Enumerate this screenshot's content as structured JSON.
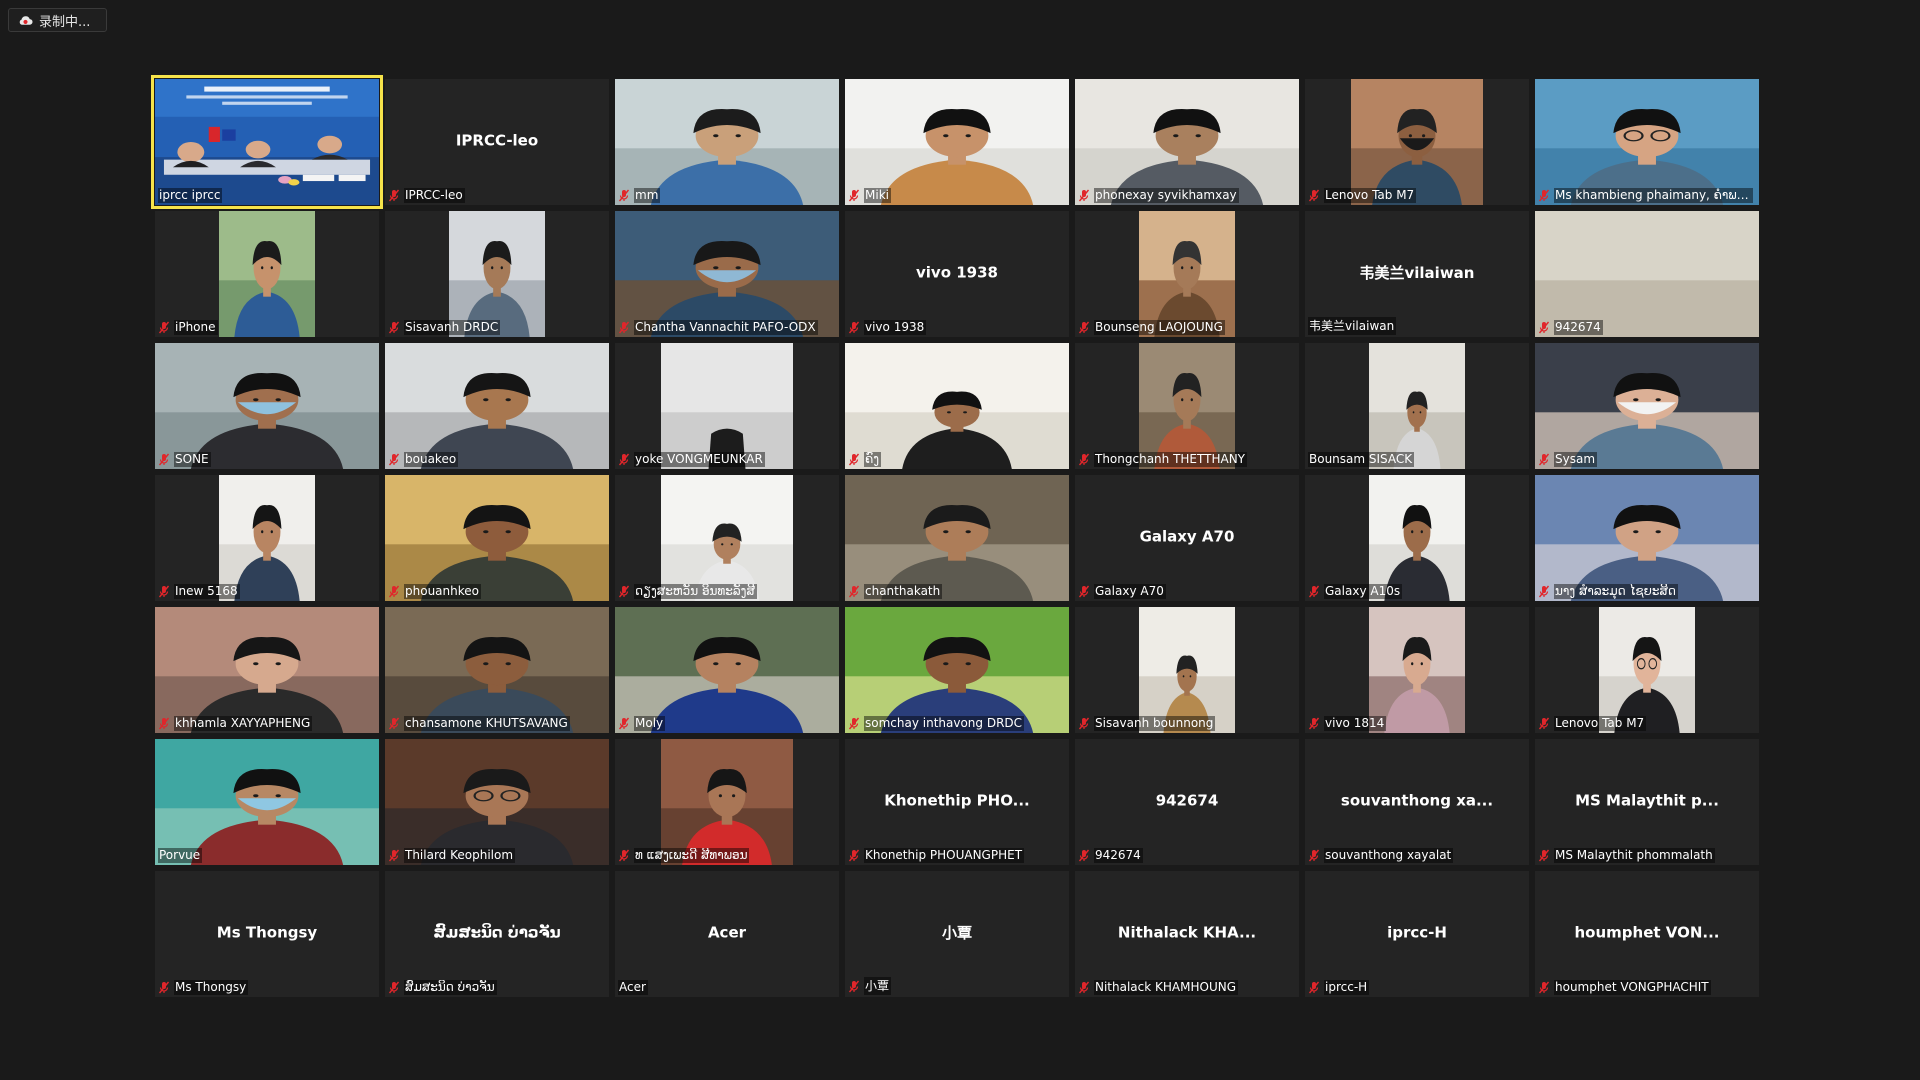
{
  "recording": {
    "label": "录制中...",
    "icon": "cloud-record-icon"
  },
  "colors": {
    "active_speaker_border": "#f6e34a",
    "tile_bg": "#242424",
    "mute_icon": "#e0262b"
  },
  "participants": [
    {
      "display_name": "iprcc iprcc",
      "center_name": "",
      "muted": false,
      "video": true,
      "active": true
    },
    {
      "display_name": "IPRCC-leo",
      "center_name": "IPRCC-leo",
      "muted": true,
      "video": false
    },
    {
      "display_name": "mm",
      "center_name": "",
      "muted": true,
      "video": true
    },
    {
      "display_name": "Miki",
      "center_name": "",
      "muted": true,
      "video": true
    },
    {
      "display_name": "phonexay syvikhamxay",
      "center_name": "",
      "muted": true,
      "video": true
    },
    {
      "display_name": "Lenovo Tab M7",
      "center_name": "",
      "muted": true,
      "video": true
    },
    {
      "display_name": "Ms khambieng phaimany, ຄຳພຽງ...",
      "center_name": "",
      "muted": true,
      "video": true
    },
    {
      "display_name": "iPhone",
      "center_name": "",
      "muted": true,
      "video": true
    },
    {
      "display_name": "Sisavanh DRDC",
      "center_name": "",
      "muted": true,
      "video": true
    },
    {
      "display_name": "Chantha Vannachit PAFO-ODX",
      "center_name": "",
      "muted": true,
      "video": true
    },
    {
      "display_name": "vivo 1938",
      "center_name": "vivo 1938",
      "muted": true,
      "video": false
    },
    {
      "display_name": "Bounseng LAOJOUNG",
      "center_name": "",
      "muted": true,
      "video": true
    },
    {
      "display_name": "韦美兰vilaiwan",
      "center_name": "韦美兰vilaiwan",
      "muted": false,
      "video": false
    },
    {
      "display_name": "942674",
      "center_name": "",
      "muted": true,
      "video": true
    },
    {
      "display_name": "SONE",
      "center_name": "",
      "muted": true,
      "video": true
    },
    {
      "display_name": "bouakeo",
      "center_name": "",
      "muted": true,
      "video": true
    },
    {
      "display_name": "yoke VONGMEUNKAR",
      "center_name": "",
      "muted": true,
      "video": true
    },
    {
      "display_name": "ຄົງ",
      "center_name": "",
      "muted": true,
      "video": true
    },
    {
      "display_name": "Thongchanh THETTHANY",
      "center_name": "",
      "muted": true,
      "video": true
    },
    {
      "display_name": "Bounsam SISACK",
      "center_name": "",
      "muted": false,
      "video": true
    },
    {
      "display_name": "Sysam",
      "center_name": "",
      "muted": true,
      "video": true
    },
    {
      "display_name": "Inew 5168",
      "center_name": "",
      "muted": true,
      "video": true
    },
    {
      "display_name": "phouanhkeo",
      "center_name": "",
      "muted": true,
      "video": true
    },
    {
      "display_name": "ດຽງສະຫວັນ ອິນທະລັງສີ",
      "center_name": "",
      "muted": true,
      "video": true
    },
    {
      "display_name": "chanthakath",
      "center_name": "",
      "muted": true,
      "video": true
    },
    {
      "display_name": "Galaxy A70",
      "center_name": "Galaxy A70",
      "muted": true,
      "video": false
    },
    {
      "display_name": "Galaxy A10s",
      "center_name": "",
      "muted": true,
      "video": true
    },
    {
      "display_name": "ນາງ ສຳລະມຸດ ໄຊຍະສິດ",
      "center_name": "",
      "muted": true,
      "video": true
    },
    {
      "display_name": "khhamla XAYYAPHENG",
      "center_name": "",
      "muted": true,
      "video": true
    },
    {
      "display_name": "chansamone KHUTSAVANG",
      "center_name": "",
      "muted": true,
      "video": true
    },
    {
      "display_name": "Moly",
      "center_name": "",
      "muted": true,
      "video": true
    },
    {
      "display_name": "somchay inthavong DRDC",
      "center_name": "",
      "muted": true,
      "video": true
    },
    {
      "display_name": "Sisavanh bounnong",
      "center_name": "",
      "muted": true,
      "video": true
    },
    {
      "display_name": "vivo 1814",
      "center_name": "",
      "muted": true,
      "video": true
    },
    {
      "display_name": "Lenovo Tab M7",
      "center_name": "",
      "muted": true,
      "video": true
    },
    {
      "display_name": "Porvue",
      "center_name": "",
      "muted": false,
      "video": true
    },
    {
      "display_name": "Thilard Keophilom",
      "center_name": "",
      "muted": true,
      "video": true
    },
    {
      "display_name": "ທ ແສງເພະດີ ສີທາພອນ",
      "center_name": "",
      "muted": true,
      "video": true
    },
    {
      "display_name": "Khonethip PHOUANGPHET",
      "center_name": "Khonethip  PHO...",
      "muted": true,
      "video": false
    },
    {
      "display_name": "942674",
      "center_name": "942674",
      "muted": true,
      "video": false
    },
    {
      "display_name": "souvanthong xayalat",
      "center_name": "souvanthong  xa...",
      "muted": true,
      "video": false
    },
    {
      "display_name": "MS Malaythit phommalath",
      "center_name": "MS  Malaythit  p...",
      "muted": true,
      "video": false
    },
    {
      "display_name": "Ms Thongsy",
      "center_name": "Ms Thongsy",
      "muted": true,
      "video": false
    },
    {
      "display_name": "ສົມສະນິດ ບ່າວຈັນ",
      "center_name": "ສົມສະນິດ ບ່າວຈັນ",
      "muted": true,
      "video": false
    },
    {
      "display_name": "Acer",
      "center_name": "Acer",
      "muted": false,
      "video": false
    },
    {
      "display_name": "小覃",
      "center_name": "小覃",
      "muted": true,
      "video": false
    },
    {
      "display_name": "Nithalack KHAMHOUNG",
      "center_name": "Nithalack  KHA...",
      "muted": true,
      "video": false
    },
    {
      "display_name": "iprcc-H",
      "center_name": "iprcc-H",
      "muted": true,
      "video": false
    },
    {
      "display_name": "houmphet VONGPHACHIT",
      "center_name": "houmphet  VON...",
      "muted": true,
      "video": false
    }
  ]
}
